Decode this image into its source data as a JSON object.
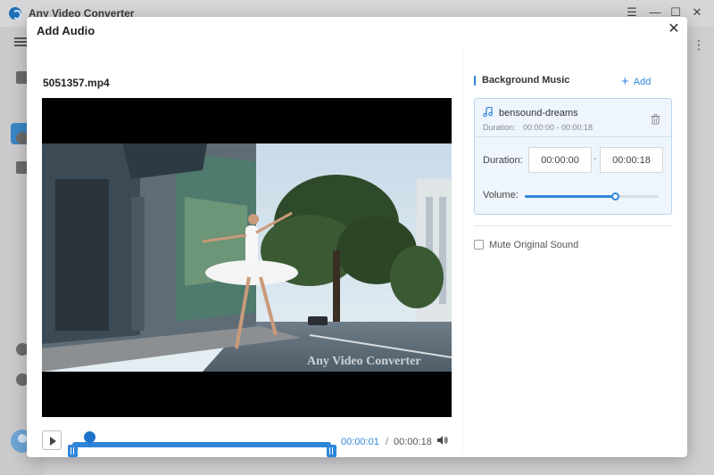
{
  "app": {
    "title": "Any Video Converter",
    "window_controls": {
      "menu": "☰",
      "minimize": "—",
      "maximize": "☐",
      "close": "✕"
    },
    "right_menu_glyph": "⋮"
  },
  "dialog": {
    "title": "Add Audio",
    "close_glyph": "✕"
  },
  "video": {
    "file_name": "5051357.mp4",
    "watermark": "Any Video Converter",
    "current_time": "00:00:01",
    "separator": "/",
    "total_time": "00:00:18",
    "playhead_fraction": 0.066,
    "trim_start_fraction": 0.0,
    "trim_end_fraction": 1.0
  },
  "background_music": {
    "section_title": "Background Music",
    "add_label": "Add",
    "track": {
      "name": "bensound-dreams",
      "duration_label": "Duration:",
      "duration_range": "00:00:00 - 00:00:18"
    },
    "duration_field_label": "Duration:",
    "start_time": "00:00:00",
    "end_time": "00:00:18",
    "range_dash": "-",
    "volume_label": "Volume:",
    "volume_fraction": 0.67
  },
  "mute_original": {
    "label": "Mute Original Sound",
    "checked": false
  },
  "colors": {
    "accent": "#2f86d9",
    "card_bg": "#eef5fc"
  }
}
